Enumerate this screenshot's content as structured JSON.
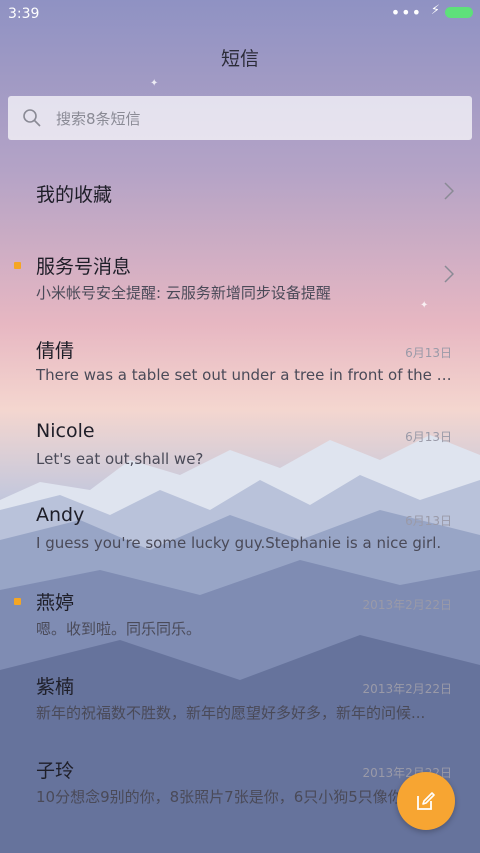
{
  "status_bar": {
    "time": "3:39",
    "signal_dots": "•••",
    "charging_glyph": "⚡"
  },
  "header": {
    "title": "短信"
  },
  "search": {
    "placeholder": "搜索8条短信"
  },
  "favorites": {
    "label": "我的收藏"
  },
  "conversations": [
    {
      "name": "服务号消息",
      "preview": "小米帐号安全提醒: 云服务新增同步设备提醒",
      "date": "",
      "unread": true
    },
    {
      "name": "倩倩",
      "preview": "There was a table set out under a tree in front of the ho...",
      "date": "6月13日",
      "unread": false
    },
    {
      "name": "Nicole",
      "preview": "Let's eat out,shall we?",
      "date": "6月13日",
      "unread": false
    },
    {
      "name": "Andy",
      "preview": "I guess you're some lucky guy.Stephanie is a nice girl.",
      "date": "6月13日",
      "unread": false
    },
    {
      "name": "燕婷",
      "preview": "嗯。收到啦。同乐同乐。",
      "date": "2013年2月22日",
      "unread": true
    },
    {
      "name": "紫楠",
      "preview": "新年的祝福数不胜数，新年的愿望好多好多，新年的问候...",
      "date": "2013年2月22日",
      "unread": false
    },
    {
      "name": "子玲",
      "preview": "10分想念9别的你，8张照片7张是你，6只小狗5只像你...",
      "date": "2013年2月22日",
      "unread": false
    }
  ],
  "colors": {
    "accent": "#f7a532",
    "unread_dot": "#f5a623",
    "battery": "#5ee07a"
  },
  "icons": {
    "search": "search-icon",
    "compose": "compose-icon",
    "chevron": "chevron-right-icon"
  }
}
